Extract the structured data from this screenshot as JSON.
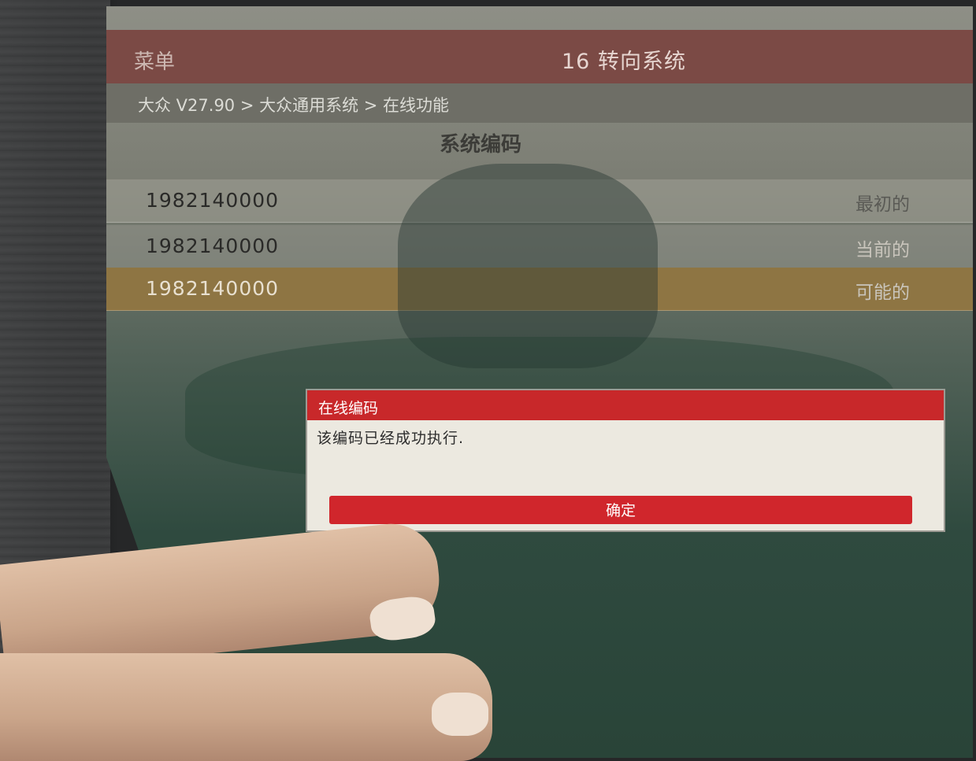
{
  "app": {
    "menu_label": "菜单",
    "title": "16 转向系统"
  },
  "breadcrumb": {
    "path": "大众 V27.90 > 大众通用系统 > 在线功能"
  },
  "section": {
    "title": "系统编码"
  },
  "code_rows": [
    {
      "value": "1982140000",
      "status": "最初的"
    },
    {
      "value": "1982140000",
      "status": "当前的"
    },
    {
      "value": "1982140000",
      "status": "可能的"
    }
  ],
  "dialog": {
    "title": "在线编码",
    "message": "该编码已经成功执行.",
    "confirm_label": "确定"
  },
  "colors": {
    "dialog_accent": "#c8282a",
    "selected_row": "#8e7543",
    "title_bar": "#7b4a45"
  }
}
